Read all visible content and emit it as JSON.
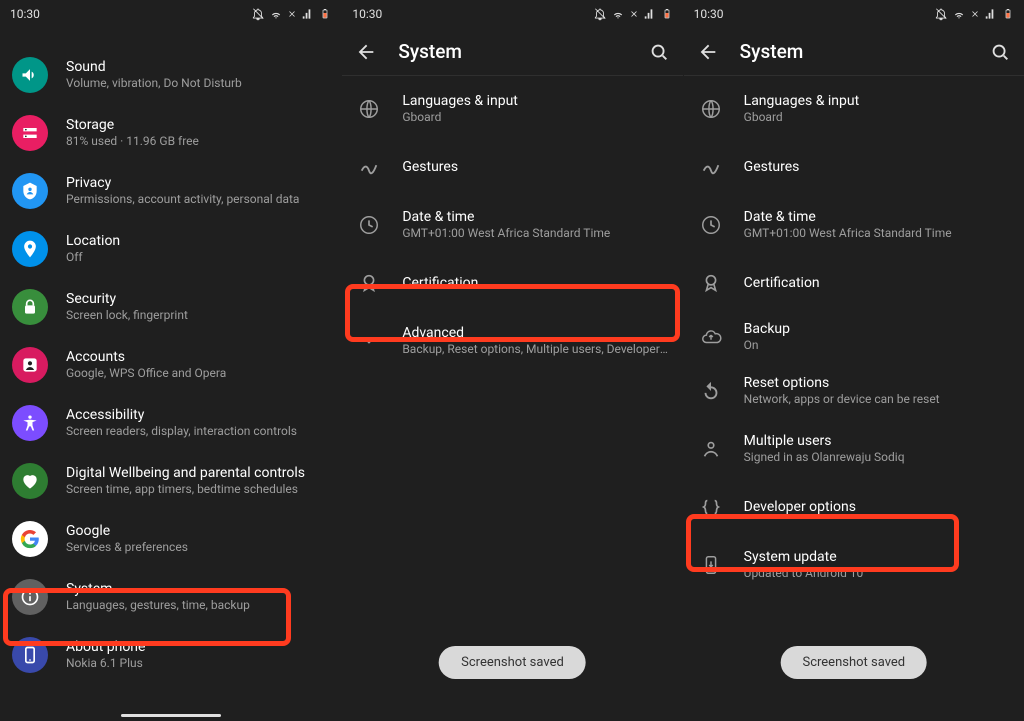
{
  "statusbar": {
    "time": "10:30"
  },
  "phoneA": {
    "items": [
      {
        "key": "sound",
        "title": "Sound",
        "subtitle": "Volume, vibration, Do Not Disturb"
      },
      {
        "key": "storage",
        "title": "Storage",
        "subtitle": "81% used · 11.96 GB free"
      },
      {
        "key": "privacy",
        "title": "Privacy",
        "subtitle": "Permissions, account activity, personal data"
      },
      {
        "key": "location",
        "title": "Location",
        "subtitle": "Off"
      },
      {
        "key": "security",
        "title": "Security",
        "subtitle": "Screen lock, fingerprint"
      },
      {
        "key": "accounts",
        "title": "Accounts",
        "subtitle": "Google, WPS Office and Opera"
      },
      {
        "key": "accessibility",
        "title": "Accessibility",
        "subtitle": "Screen readers, display, interaction controls"
      },
      {
        "key": "wellbeing",
        "title": "Digital Wellbeing and parental controls",
        "subtitle": "Screen time, app timers, bedtime schedules"
      },
      {
        "key": "google",
        "title": "Google",
        "subtitle": "Services & preferences"
      },
      {
        "key": "system",
        "title": "System",
        "subtitle": "Languages, gestures, time, backup"
      },
      {
        "key": "about",
        "title": "About phone",
        "subtitle": "Nokia 6.1 Plus"
      }
    ]
  },
  "phoneB": {
    "header": "System",
    "items": [
      {
        "key": "lang",
        "title": "Languages & input",
        "subtitle": "Gboard"
      },
      {
        "key": "gestures",
        "title": "Gestures",
        "subtitle": ""
      },
      {
        "key": "date",
        "title": "Date & time",
        "subtitle": "GMT+01:00 West Africa Standard Time"
      },
      {
        "key": "cert",
        "title": "Certification",
        "subtitle": ""
      },
      {
        "key": "advanced",
        "title": "Advanced",
        "subtitle": "Backup, Reset options, Multiple users, Developer o.."
      }
    ],
    "toast": "Screenshot saved"
  },
  "phoneC": {
    "header": "System",
    "items": [
      {
        "key": "lang",
        "title": "Languages & input",
        "subtitle": "Gboard"
      },
      {
        "key": "gestures",
        "title": "Gestures",
        "subtitle": ""
      },
      {
        "key": "date",
        "title": "Date & time",
        "subtitle": "GMT+01:00 West Africa Standard Time"
      },
      {
        "key": "cert",
        "title": "Certification",
        "subtitle": ""
      },
      {
        "key": "backup",
        "title": "Backup",
        "subtitle": "On"
      },
      {
        "key": "reset",
        "title": "Reset options",
        "subtitle": "Network, apps or device can be reset"
      },
      {
        "key": "multi",
        "title": "Multiple users",
        "subtitle": "Signed in as Olanrewaju Sodiq"
      },
      {
        "key": "dev",
        "title": "Developer options",
        "subtitle": ""
      },
      {
        "key": "update",
        "title": "System update",
        "subtitle": "Updated to Android 10"
      }
    ],
    "toast": "Screenshot saved"
  }
}
